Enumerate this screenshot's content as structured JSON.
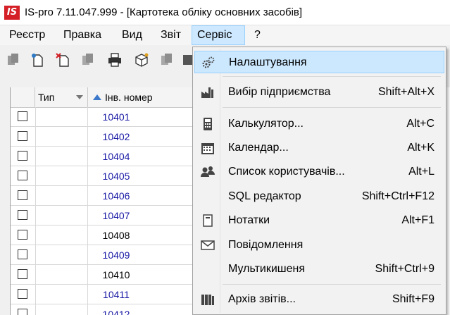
{
  "window": {
    "logo_text": "IS",
    "title": "IS-pro 7.11.047.999 - [Картотека обліку основних засобів]"
  },
  "menubar": {
    "items": [
      "Реєстр",
      "Правка",
      "Вид",
      "Звіт",
      "Сервіс",
      "?"
    ],
    "active": "Сервіс"
  },
  "grid": {
    "headers": {
      "type": "Тип",
      "inv": "Інв. номер"
    },
    "rows": [
      {
        "inv": "10401",
        "color": "blue"
      },
      {
        "inv": "10402",
        "color": "blue"
      },
      {
        "inv": "10404",
        "color": "blue"
      },
      {
        "inv": "10405",
        "color": "blue"
      },
      {
        "inv": "10406",
        "color": "blue"
      },
      {
        "inv": "10407",
        "color": "blue"
      },
      {
        "inv": "10408",
        "color": "black"
      },
      {
        "inv": "10409",
        "color": "blue"
      },
      {
        "inv": "10410",
        "color": "black"
      },
      {
        "inv": "10411",
        "color": "blue"
      },
      {
        "inv": "10412",
        "color": "blue"
      }
    ]
  },
  "service_menu": {
    "items": [
      {
        "label": "Налаштування",
        "shortcut": "",
        "icon": "gears-icon",
        "highlighted": true
      },
      {
        "label": "Вибір підприємства",
        "shortcut": "Shift+Alt+X",
        "icon": "factory-icon"
      },
      {
        "label": "Калькулятор...",
        "shortcut": "Alt+C",
        "icon": "calculator-icon"
      },
      {
        "label": "Календар...",
        "shortcut": "Alt+K",
        "icon": "calendar-icon"
      },
      {
        "label": "Список користувачів...",
        "shortcut": "Alt+L",
        "icon": "users-icon"
      },
      {
        "label": "SQL редактор",
        "shortcut": "Shift+Ctrl+F12",
        "icon": ""
      },
      {
        "label": "Нотатки",
        "shortcut": "Alt+F1",
        "icon": "note-icon"
      },
      {
        "label": "Повідомлення",
        "shortcut": "",
        "icon": "envelope-icon"
      },
      {
        "label": "Мультикишеня",
        "shortcut": "Shift+Ctrl+9",
        "icon": ""
      },
      {
        "label": "Архів звітів...",
        "shortcut": "Shift+F9",
        "icon": "archive-icon"
      }
    ]
  },
  "colors": {
    "menu_highlight": "#cce8ff",
    "logo_red": "#d41f26",
    "link_blue": "#1a1aa6"
  }
}
